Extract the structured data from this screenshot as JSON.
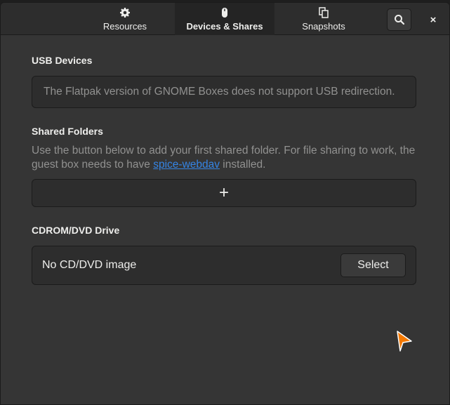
{
  "header": {
    "tabs": [
      {
        "label": "Resources",
        "icon": "gear-icon"
      },
      {
        "label": "Devices & Shares",
        "icon": "mouse-icon",
        "active": true
      },
      {
        "label": "Snapshots",
        "icon": "snapshots-icon"
      }
    ],
    "search_icon": "search-icon",
    "close_label": "×"
  },
  "usb": {
    "title": "USB Devices",
    "message": "The Flatpak version of GNOME Boxes does not support USB redirection."
  },
  "shared": {
    "title": "Shared Folders",
    "desc_before": "Use the button below to add your first shared folder. For file sharing to work, the guest box needs to have ",
    "link": "spice-webdav",
    "desc_after": " installed.",
    "add_label": "+"
  },
  "cdrom": {
    "title": "CDROM/DVD Drive",
    "status": "No CD/DVD image",
    "select_label": "Select"
  },
  "colors": {
    "accent": "#3584e4",
    "cursor": "#f57900"
  }
}
